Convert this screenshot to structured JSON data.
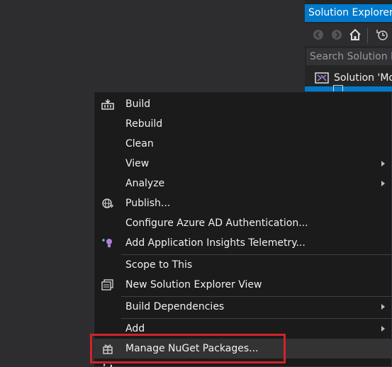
{
  "solution_explorer": {
    "title": "Solution Explorer",
    "search_placeholder": "Search Solution E",
    "solution_label": "Solution 'Mo"
  },
  "context_menu": {
    "items": [
      {
        "label": "Build",
        "icon": "build-icon",
        "submenu": false
      },
      {
        "label": "Rebuild",
        "icon": "",
        "submenu": false
      },
      {
        "label": "Clean",
        "icon": "",
        "submenu": false
      },
      {
        "label": "View",
        "icon": "",
        "submenu": true
      },
      {
        "label": "Analyze",
        "icon": "",
        "submenu": true
      },
      {
        "label": "Publish...",
        "icon": "publish-globe-icon",
        "submenu": false
      },
      {
        "label": "Configure Azure AD Authentication...",
        "icon": "",
        "submenu": false
      },
      {
        "label": "Add Application Insights Telemetry...",
        "icon": "app-insights-icon",
        "submenu": false
      },
      {
        "label": "Scope to This",
        "icon": "",
        "submenu": false
      },
      {
        "label": "New Solution Explorer View",
        "icon": "new-view-icon",
        "submenu": false
      },
      {
        "label": "Build Dependencies",
        "icon": "",
        "submenu": true
      },
      {
        "label": "Add",
        "icon": "",
        "submenu": true
      },
      {
        "label": "Manage NuGet Packages...",
        "icon": "nuget-package-icon",
        "submenu": false
      }
    ]
  },
  "colors": {
    "accent": "#007acc",
    "highlight_border": "#d1232a"
  }
}
